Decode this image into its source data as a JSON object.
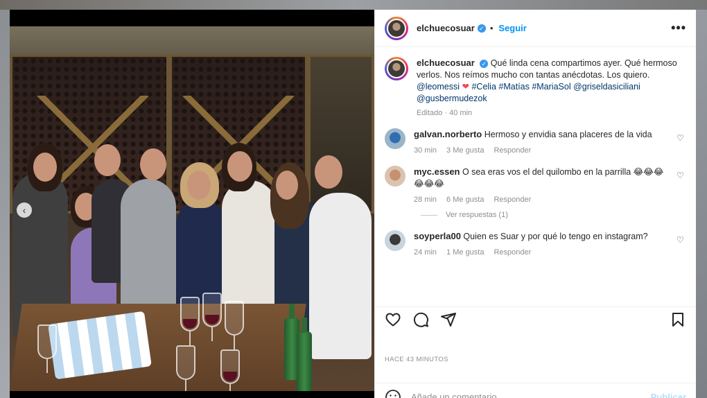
{
  "post": {
    "author": "elchuecosuar",
    "follow_label": "Seguir",
    "separator": "•",
    "more_label": "•••",
    "caption": {
      "username": "elchuecosuar",
      "text": "Qué linda cena compartimos ayer. Qué hermoso verlos. Nos reímos mucho con tantas anécdotas. Los quiero.",
      "mention_1": "@leomessi",
      "heart": "❤",
      "tags": "#Celia #Matías #MariaSol",
      "mention_2": "@griseldasiciliani",
      "mention_3": "@gusbermudezok",
      "edited": "Editado · 40 min"
    },
    "comments": [
      {
        "username": "galvan.norberto",
        "text": "Hermoso y envidia sana placeres de la vida",
        "time": "30 min",
        "likes": "3 Me gusta",
        "reply": "Responder"
      },
      {
        "username": "myc.essen",
        "text": "O sea eras vos el del quilombo en la parrilla 😂😂😂😂😂😂",
        "time": "28 min",
        "likes": "6 Me gusta",
        "reply": "Responder"
      },
      {
        "username": "soyperla00",
        "text": "Quien es Suar y por qué lo tengo en instagram?",
        "time": "24 min",
        "likes": "1 Me gusta",
        "reply": "Responder"
      }
    ],
    "view_replies": "Ver respuestas (1)",
    "timestamp": "HACE 43 MINUTOS",
    "add_comment_placeholder": "Añade un comentario...",
    "publish_label": "Publicar"
  },
  "colors": {
    "link": "#0095f6",
    "tag": "#00376b",
    "muted": "#8e8e8e",
    "heart": "#ed4956"
  },
  "icons": [
    "heart-icon",
    "comment-icon",
    "share-icon",
    "bookmark-icon",
    "emoji-icon",
    "chevron-left-icon",
    "verified-icon",
    "more-options-icon"
  ]
}
